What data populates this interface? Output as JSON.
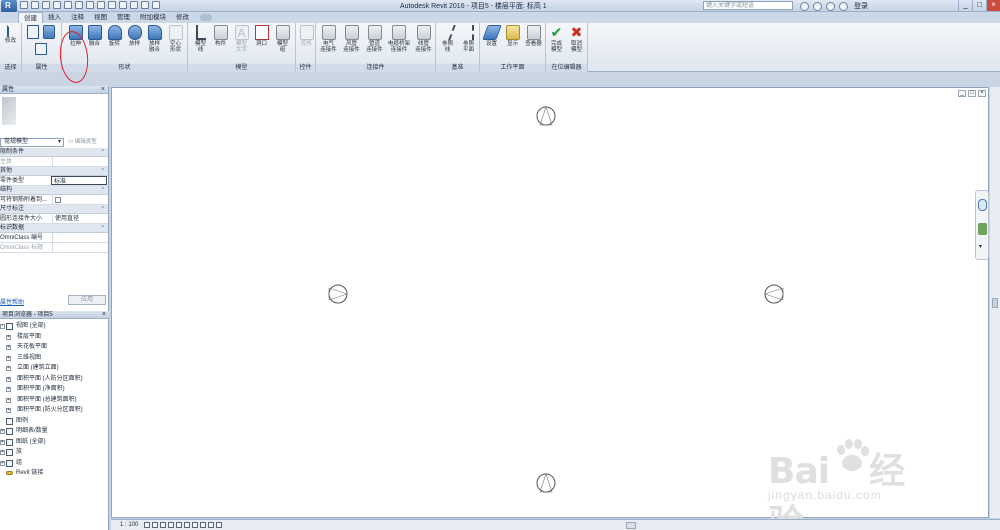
{
  "titlebar": {
    "title": "Autodesk Revit 2016 -   项目5 - 楼层平面: 标高 1",
    "search_placeholder": "键入关键字或短语",
    "login": "登录",
    "win_min": "_",
    "win_max": "□",
    "win_close": "×"
  },
  "tabs": [
    "创建",
    "插入",
    "注释",
    "视图",
    "管理",
    "附加模块",
    "修改"
  ],
  "ribbon": {
    "select_label": "修改",
    "select_group": "选择",
    "props_group": "属性",
    "buttons": [
      {
        "label": "拉伸"
      },
      {
        "label": "融合"
      },
      {
        "label": "旋转"
      },
      {
        "label": "放样"
      },
      {
        "label": "放样\n融合"
      },
      {
        "label": "空心\n形状"
      },
      {
        "label": "模型\n线"
      },
      {
        "label": "构件"
      },
      {
        "label": "模型\n文字"
      },
      {
        "label": "洞口"
      },
      {
        "label": "模型\n组"
      },
      {
        "label": "控件"
      },
      {
        "label": "电气\n连接件"
      },
      {
        "label": "风管\n连接件"
      },
      {
        "label": "管道\n连接件"
      },
      {
        "label": "电缆桥架\n连接件"
      },
      {
        "label": "线管\n连接件"
      },
      {
        "label": "参照\n线"
      },
      {
        "label": "参照\n平面"
      },
      {
        "label": "设置"
      },
      {
        "label": "显示"
      },
      {
        "label": "查看器"
      },
      {
        "label": "完成\n模型"
      },
      {
        "label": "取消\n模型"
      }
    ],
    "groups": {
      "shape": "形状",
      "model": "模型",
      "control": "控件",
      "connectors": "连接件",
      "datum": "基准",
      "workplane": "工作平面",
      "inplace": "在位编辑器"
    }
  },
  "properties": {
    "header": "属性",
    "type_name": "常规模型",
    "edit_type": "编辑类型",
    "categories": [
      {
        "name": "限制条件",
        "rows": [
          {
            "k": "主体",
            "v": "",
            "muted": true
          }
        ]
      },
      {
        "name": "其他",
        "rows": [
          {
            "k": "零件类型",
            "v": "标准",
            "boxed": true
          }
        ]
      },
      {
        "name": "结构",
        "rows": [
          {
            "k": "可将钢筋附着到...",
            "v": "",
            "check": true
          }
        ]
      },
      {
        "name": "尺寸标注",
        "rows": [
          {
            "k": "圆形连接件大小",
            "v": "使用直径"
          }
        ]
      },
      {
        "name": "标识数据",
        "rows": [
          {
            "k": "OmniClass 编号",
            "v": ""
          },
          {
            "k": "OmniClass 标题",
            "v": "",
            "muted": true
          }
        ]
      }
    ],
    "help": "属性帮助",
    "apply": "应用"
  },
  "browser": {
    "header": "项目浏览器 - 项目5",
    "items": [
      {
        "text": "视图 (全部)",
        "level": 0,
        "exp": "-",
        "icon": "views-icon"
      },
      {
        "text": "楼层平面",
        "level": 1,
        "exp": "+"
      },
      {
        "text": "天花板平面",
        "level": 1,
        "exp": "+"
      },
      {
        "text": "三维视图",
        "level": 1,
        "exp": "+"
      },
      {
        "text": "立面 (建筑立面)",
        "level": 1,
        "exp": "+"
      },
      {
        "text": "面积平面 (人防分区面积)",
        "level": 1,
        "exp": "+"
      },
      {
        "text": "面积平面 (净面积)",
        "level": 1,
        "exp": "+"
      },
      {
        "text": "面积平面 (总建筑面积)",
        "level": 1,
        "exp": "+"
      },
      {
        "text": "面积平面 (防火分区面积)",
        "level": 1,
        "exp": "+"
      },
      {
        "text": "图例",
        "level": 0,
        "exp": "",
        "icon": "legend-icon"
      },
      {
        "text": "明细表/数量",
        "level": 0,
        "exp": "+",
        "icon": "schedule-icon"
      },
      {
        "text": "图纸 (全部)",
        "level": 0,
        "exp": "+",
        "icon": "sheet-icon"
      },
      {
        "text": "族",
        "level": 0,
        "exp": "+",
        "icon": "family-icon"
      },
      {
        "text": "组",
        "level": 0,
        "exp": "+",
        "icon": "group-icon"
      },
      {
        "text": "Revit 链接",
        "level": 0,
        "exp": "",
        "icon": "link-icon"
      }
    ]
  },
  "statusbar": {
    "scale": "1 : 100"
  },
  "watermark": {
    "logo": "Bai  经验",
    "url": "jingyan.baidu.com"
  }
}
